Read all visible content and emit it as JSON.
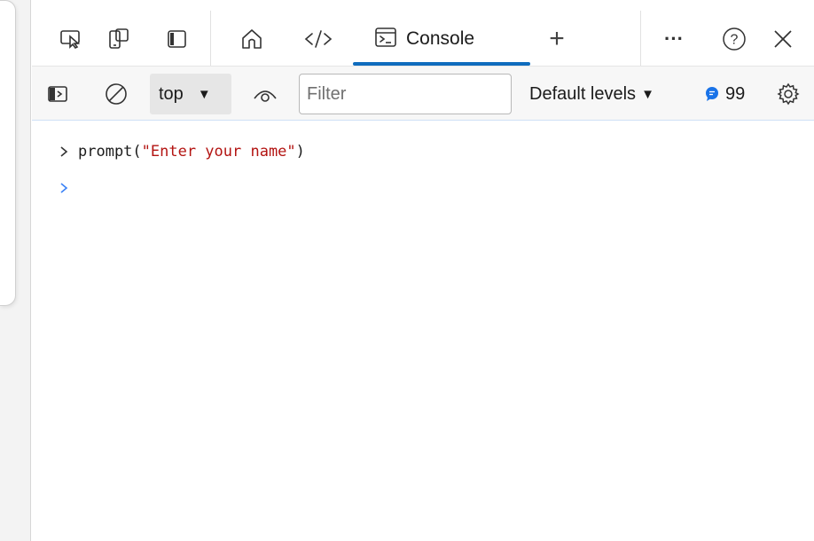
{
  "toolbar": {
    "tabs": [
      {
        "name": "Inspect tool",
        "icon": "inspect-icon"
      },
      {
        "name": "Device emulation",
        "icon": "device-icon"
      },
      {
        "name": "Dock panel",
        "icon": "panel-icon"
      },
      {
        "name": "Welcome",
        "icon": "home-icon"
      },
      {
        "name": "Elements",
        "icon": "code-icon"
      }
    ],
    "active_tab": {
      "label": "Console",
      "icon": "console-icon"
    },
    "add_tab": "+",
    "more": "···",
    "help": "?",
    "close": "✕"
  },
  "console_bar": {
    "context": "top",
    "filter_placeholder": "Filter",
    "filter_value": "",
    "levels": "Default levels",
    "issues_count": "99"
  },
  "console": {
    "entries": [
      {
        "fn": "prompt(",
        "arg": "\"Enter your name\"",
        "close": ")"
      }
    ]
  },
  "colors": {
    "accent": "#0f6cbd",
    "string": "#b31412",
    "prompt_chevron": "#3b82f6"
  }
}
